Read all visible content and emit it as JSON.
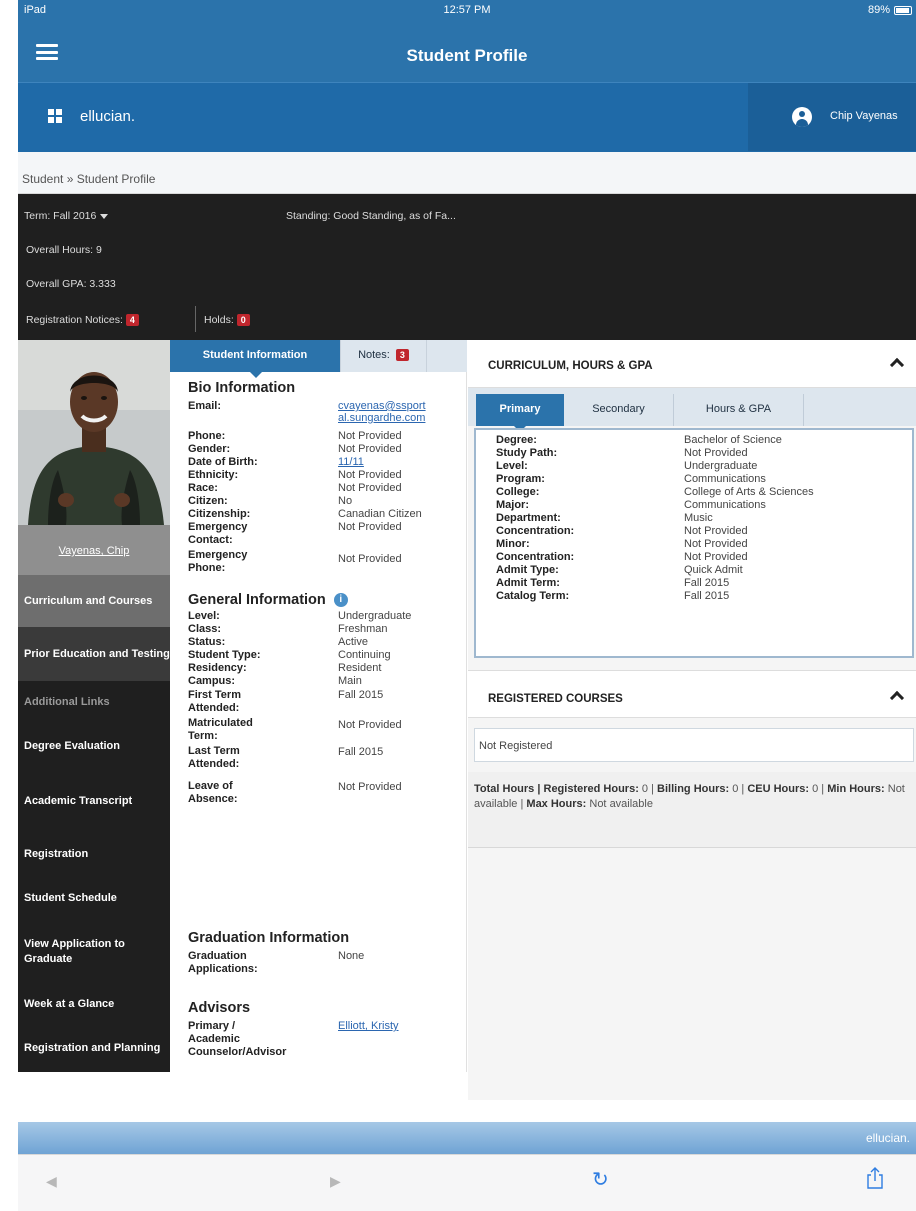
{
  "status_bar": {
    "carrier": "iPad",
    "time": "12:57 PM",
    "battery": "89%"
  },
  "nav": {
    "title": "Student Profile"
  },
  "header": {
    "brand": "ellucian.",
    "user_name": "Chip Vayenas"
  },
  "breadcrumb": "Student » Student Profile",
  "summary": {
    "term": "Term: Fall 2016",
    "standing": "Standing: Good Standing, as of Fa...",
    "overall_hours": "Overall Hours: 9",
    "overall_gpa": "Overall GPA: 3.333",
    "notices_label": "Registration Notices:",
    "notices_count": "4",
    "holds_label": "Holds:",
    "holds_count": "0"
  },
  "student": {
    "name": "Vayenas, Chip"
  },
  "sidebar": {
    "items": [
      "Curriculum and Courses",
      "Prior Education and Testing",
      "Additional Links",
      "Degree Evaluation",
      "Academic Transcript",
      "Registration",
      "Student Schedule",
      "View Application to Graduate",
      "Week at a Glance",
      "Registration and Planning"
    ]
  },
  "mid_tabs": {
    "student_info": "Student Information",
    "notes": "Notes:",
    "notes_count": "3"
  },
  "bio": {
    "title": "Bio Information",
    "email_label": "Email:",
    "email_line1": "cvayenas@ssport",
    "email_line2": "al.sungardhe.com",
    "rows": [
      {
        "label": "Phone:",
        "value": "Not Provided"
      },
      {
        "label": "Gender:",
        "value": "Not Provided"
      },
      {
        "label": "Date of Birth:",
        "value": "11/11"
      },
      {
        "label": "Ethnicity:",
        "value": "Not Provided"
      },
      {
        "label": "Race:",
        "value": "Not Provided"
      },
      {
        "label": "Citizen:",
        "value": "No"
      },
      {
        "label": "Citizenship:",
        "value": "Canadian Citizen"
      },
      {
        "label": "Emergency",
        "label2": "Contact:",
        "value": "Not Provided"
      },
      {
        "label": "Emergency",
        "label2": "Phone:",
        "value": "Not Provided"
      }
    ]
  },
  "general": {
    "title": "General Information",
    "rows": [
      {
        "label": "Level:",
        "value": "Undergraduate"
      },
      {
        "label": "Class:",
        "value": "Freshman"
      },
      {
        "label": "Status:",
        "value": "Active"
      },
      {
        "label": "Student Type:",
        "value": "Continuing"
      },
      {
        "label": "Residency:",
        "value": "Resident"
      },
      {
        "label": "Campus:",
        "value": "Main"
      },
      {
        "label": "First Term",
        "label2": "Attended:",
        "value": "Fall 2015"
      },
      {
        "label": "Matriculated",
        "label2": "Term:",
        "value": "Not Provided"
      },
      {
        "label": "Last Term",
        "label2": "Attended:",
        "value": "Fall 2015"
      },
      {
        "label": "Leave of",
        "label2": "Absence:",
        "value": "Not Provided"
      }
    ]
  },
  "graduation": {
    "title": "Graduation Information",
    "label": "Graduation",
    "label2": "Applications:",
    "value": "None"
  },
  "advisors": {
    "title": "Advisors",
    "label": "Primary /",
    "label2": "Academic",
    "label3": "Counselor/Advisor",
    "value": "Elliott, Kristy"
  },
  "curriculum": {
    "title": "CURRICULUM, HOURS & GPA",
    "tabs": [
      "Primary",
      "Secondary",
      "Hours & GPA"
    ],
    "rows": [
      {
        "label": "Degree:",
        "value": "Bachelor of Science"
      },
      {
        "label": "Study Path:",
        "value": "Not Provided"
      },
      {
        "label": "Level:",
        "value": "Undergraduate"
      },
      {
        "label": "Program:",
        "value": "Communications"
      },
      {
        "label": "College:",
        "value": "College of Arts & Sciences"
      },
      {
        "label": "Major:",
        "value": "Communications"
      },
      {
        "label": "Department:",
        "value": "Music"
      },
      {
        "label": "Concentration:",
        "value": "Not Provided"
      },
      {
        "label": "Minor:",
        "value": "Not Provided"
      },
      {
        "label": "Concentration:",
        "value": "Not Provided"
      },
      {
        "label": "Admit Type:",
        "value": "Quick Admit"
      },
      {
        "label": "Admit Term:",
        "value": "Fall 2015"
      },
      {
        "label": "Catalog Term:",
        "value": "Fall 2015"
      }
    ]
  },
  "registered": {
    "title": "REGISTERED COURSES",
    "empty": "Not Registered",
    "total_hours": "Total Hours |",
    "registered_hours_label": "Registered Hours:",
    "registered_hours": "0",
    "billing_hours_label": "Billing Hours:",
    "billing_hours": "0",
    "ceu_label": "CEU",
    "hours_label": "Hours:",
    "ceu_hours": "0",
    "min_hours_label": "Min Hours:",
    "min_hours": "Not available",
    "max_hours_label": "Max Hours:",
    "max_hours_1": "Not",
    "max_hours_2": "available"
  },
  "footer": {
    "brand": "ellucian."
  },
  "browser": {
    "back": "◀",
    "forward": "▶",
    "reload": "↻"
  }
}
